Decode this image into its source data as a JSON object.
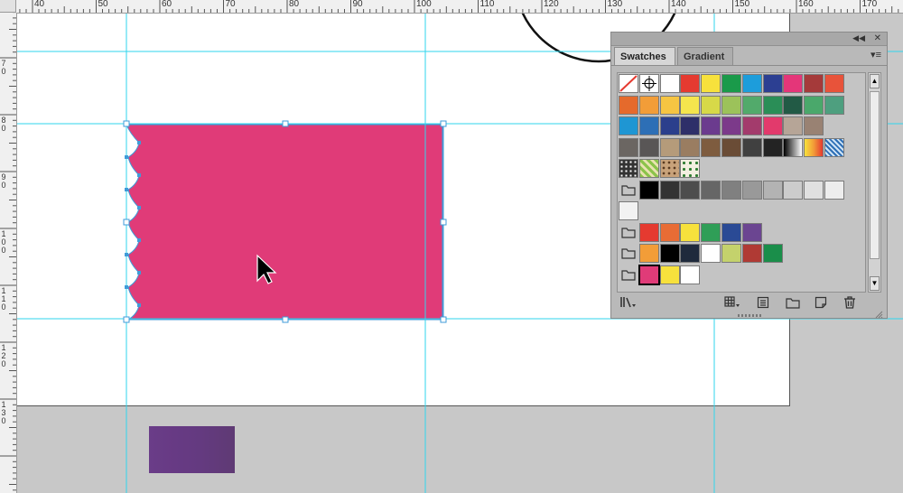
{
  "ruler": {
    "top_labels": [
      "40",
      "50",
      "60",
      "70",
      "80",
      "90",
      "100",
      "110",
      "120",
      "130",
      "140",
      "150",
      "160",
      "170"
    ],
    "left_labels": [
      "7\n0",
      "8\n0",
      "9\n0",
      "1\n0\n0",
      "1\n1\n0",
      "1\n2\n0",
      "1\n3\n0"
    ]
  },
  "colors": {
    "selected_fill": "#e03b78",
    "guide": "#2fd6ee",
    "selection": "#3f9bd8",
    "purple_rect": "#693e86"
  },
  "panel": {
    "tabs": [
      "Swatches",
      "Gradient"
    ],
    "collapse_icon": "double-chevron-left-icon",
    "close_icon": "close-icon",
    "menu_icon": "panel-menu-icon",
    "swatch_rows": [
      [
        "none",
        "registration",
        "#ffffff",
        "#e53a30",
        "#f7e13c",
        "#1a9a4a",
        "#1d9ddb",
        "#2c3f92",
        "#e43679",
        "#a53a3a",
        "#e8533a"
      ],
      [
        "#e56a2c",
        "#f29d38",
        "#f6c542",
        "#f5e54d",
        "#d7d948",
        "#9cc25a",
        "#52aa6b",
        "#2a8e57",
        "#225a45",
        "#4aa86b",
        "#4e9f7f"
      ],
      [
        "#1f96d3",
        "#2d6fb6",
        "#2b3f8c",
        "#2e2f69",
        "#6b3b8e",
        "#7c3a8a",
        "#a33b6c",
        "#e23a6c",
        "#b6a597",
        "#998273",
        ""
      ],
      [
        "#6b6662",
        "#595656",
        "#b59b7a",
        "#9a7d61",
        "#7e5c3f",
        "#6a4c36",
        "#404040",
        "#232323",
        "gradient-bw",
        "gradient-orange",
        "gradient-blue"
      ],
      [
        "pattern-dots",
        "pattern-green",
        "pattern-leopard",
        "pattern-trees",
        "",
        "",
        "",
        "",
        "",
        "",
        ""
      ],
      [
        "folder",
        "#000000",
        "#333333",
        "#4d4d4d",
        "#666666",
        "#808080",
        "#999999",
        "#b3b3b3",
        "#cccccc",
        "#e0e0e0",
        "#ededed"
      ],
      [
        "#f2f2f2",
        "",
        "",
        "",
        "",
        "",
        "",
        "",
        "",
        "",
        ""
      ],
      [
        "folder",
        "#e53a30",
        "#e86c35",
        "#f7e13c",
        "#2f9e57",
        "#2a4a95",
        "#6b4591",
        "",
        "",
        "",
        ""
      ],
      [
        "folder",
        "#f29d38",
        "#000000",
        "#1f2a3c",
        "#ffffff",
        "#c4d26c",
        "#b03a34",
        "#1a8e4a",
        "",
        "",
        ""
      ],
      [
        "folder",
        "#e03b78",
        "#f7e13c",
        "#ffffff",
        "",
        "",
        "",
        "",
        "",
        "",
        ""
      ]
    ],
    "bottom_icons": [
      "swatch-libraries-icon",
      "show-kinds-icon",
      "swatch-options-icon",
      "new-color-group-icon",
      "new-swatch-icon",
      "delete-swatch-icon"
    ]
  }
}
